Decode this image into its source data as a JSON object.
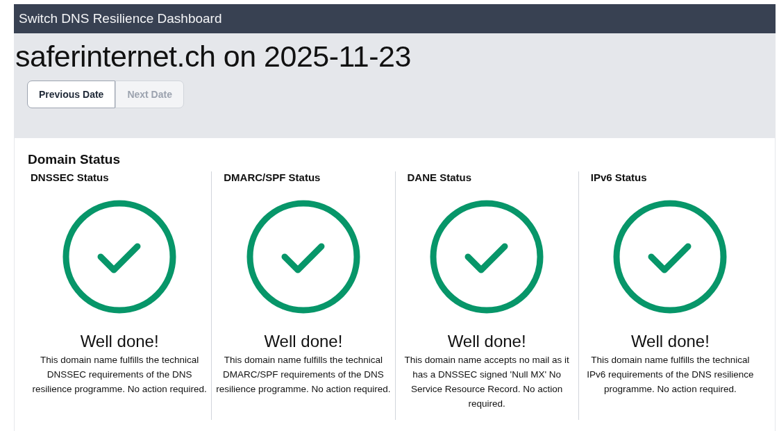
{
  "app_title": "Switch DNS Resilience Dashboard",
  "page_title": "saferinternet.ch on 2025-11-23",
  "buttons": [
    {
      "label": "Previous Date",
      "disabled": false
    },
    {
      "label": "Next Date",
      "disabled": true
    }
  ],
  "section_title": "Domain Status",
  "statuses": [
    {
      "title": "DNSSEC Status",
      "kind": "ok",
      "headline": "Well done!",
      "description": "This domain name fulfills the technical DNSSEC requirements of the DNS resilience programme. No action required."
    },
    {
      "title": "DMARC/SPF Status",
      "kind": "ok",
      "headline": "Well done!",
      "description": "This domain name fulfills the technical DMARC/SPF requirements of the DNS resilience programme. No action required."
    },
    {
      "title": "DANE Status",
      "kind": "ok",
      "headline": "Well done!",
      "description": "This domain name accepts no mail as it has a DNSSEC signed 'Null MX' No Service Resource Record. No action required."
    },
    {
      "title": "IPv6 Status",
      "kind": "ok",
      "headline": "Well done!",
      "description": "This domain name fulfills the technical IPv6 requirements of the DNS resilience programme. No action required."
    }
  ]
}
